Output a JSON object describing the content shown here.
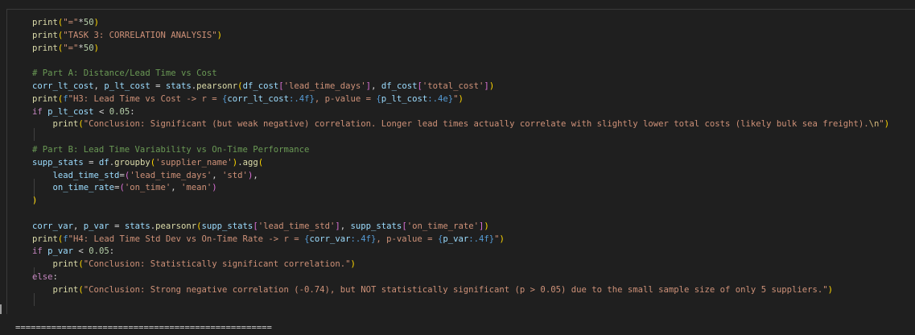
{
  "code_lines": [
    [
      {
        "t": "print",
        "c": "fn"
      },
      {
        "t": "(",
        "c": "br1"
      },
      {
        "t": "\"=\"",
        "c": "str"
      },
      {
        "t": "*",
        "c": "op"
      },
      {
        "t": "50",
        "c": "num"
      },
      {
        "t": ")",
        "c": "br1"
      }
    ],
    [
      {
        "t": "print",
        "c": "fn"
      },
      {
        "t": "(",
        "c": "br1"
      },
      {
        "t": "\"TASK 3: CORRELATION ANALYSIS\"",
        "c": "str"
      },
      {
        "t": ")",
        "c": "br1"
      }
    ],
    [
      {
        "t": "print",
        "c": "fn"
      },
      {
        "t": "(",
        "c": "br1"
      },
      {
        "t": "\"=\"",
        "c": "str"
      },
      {
        "t": "*",
        "c": "op"
      },
      {
        "t": "50",
        "c": "num"
      },
      {
        "t": ")",
        "c": "br1"
      }
    ],
    [],
    [
      {
        "t": "# Part A: Distance/Lead Time vs Cost",
        "c": "cm"
      }
    ],
    [
      {
        "t": "corr_lt_cost",
        "c": "var"
      },
      {
        "t": ", ",
        "c": "op"
      },
      {
        "t": "p_lt_cost",
        "c": "var"
      },
      {
        "t": " = ",
        "c": "op"
      },
      {
        "t": "stats",
        "c": "var"
      },
      {
        "t": ".",
        "c": "op"
      },
      {
        "t": "pearsonr",
        "c": "fn"
      },
      {
        "t": "(",
        "c": "br1"
      },
      {
        "t": "df_cost",
        "c": "var"
      },
      {
        "t": "[",
        "c": "br2"
      },
      {
        "t": "'lead_time_days'",
        "c": "str"
      },
      {
        "t": "]",
        "c": "br2"
      },
      {
        "t": ", ",
        "c": "op"
      },
      {
        "t": "df_cost",
        "c": "var"
      },
      {
        "t": "[",
        "c": "br2"
      },
      {
        "t": "'total_cost'",
        "c": "str"
      },
      {
        "t": "]",
        "c": "br2"
      },
      {
        "t": ")",
        "c": "br1"
      }
    ],
    [
      {
        "t": "print",
        "c": "fn"
      },
      {
        "t": "(",
        "c": "br1"
      },
      {
        "t": "f",
        "c": "ph"
      },
      {
        "t": "\"H3: Lead Time vs Cost -> r = ",
        "c": "str"
      },
      {
        "t": "{",
        "c": "ph"
      },
      {
        "t": "corr_lt_cost",
        "c": "var"
      },
      {
        "t": ":.4f",
        "c": "ph"
      },
      {
        "t": "}",
        "c": "ph"
      },
      {
        "t": ", p-value = ",
        "c": "str"
      },
      {
        "t": "{",
        "c": "ph"
      },
      {
        "t": "p_lt_cost",
        "c": "var"
      },
      {
        "t": ":.4e",
        "c": "ph"
      },
      {
        "t": "}",
        "c": "ph"
      },
      {
        "t": "\"",
        "c": "str"
      },
      {
        "t": ")",
        "c": "br1"
      }
    ],
    [
      {
        "t": "if",
        "c": "kw"
      },
      {
        "t": " ",
        "c": "op"
      },
      {
        "t": "p_lt_cost",
        "c": "var"
      },
      {
        "t": " < ",
        "c": "op"
      },
      {
        "t": "0.05",
        "c": "num"
      },
      {
        "t": ":",
        "c": "op"
      }
    ],
    [
      {
        "t": "    ",
        "c": "op"
      },
      {
        "t": "print",
        "c": "fn"
      },
      {
        "t": "(",
        "c": "br1"
      },
      {
        "t": "\"Conclusion: Significant (but weak negative) correlation. Longer lead times actually correlate with slightly lower total costs (likely bulk sea freight).",
        "c": "str"
      },
      {
        "t": "\\n",
        "c": "esc"
      },
      {
        "t": "\"",
        "c": "str"
      },
      {
        "t": ")",
        "c": "br1"
      }
    ],
    [],
    [
      {
        "t": "# Part B: Lead Time Variability vs On-Time Performance",
        "c": "cm"
      }
    ],
    [
      {
        "t": "supp_stats",
        "c": "var"
      },
      {
        "t": " = ",
        "c": "op"
      },
      {
        "t": "df",
        "c": "var"
      },
      {
        "t": ".",
        "c": "op"
      },
      {
        "t": "groupby",
        "c": "fn"
      },
      {
        "t": "(",
        "c": "br1"
      },
      {
        "t": "'supplier_name'",
        "c": "str"
      },
      {
        "t": ")",
        "c": "br1"
      },
      {
        "t": ".",
        "c": "op"
      },
      {
        "t": "agg",
        "c": "fn"
      },
      {
        "t": "(",
        "c": "br1"
      }
    ],
    [
      {
        "t": "    ",
        "c": "op"
      },
      {
        "t": "lead_time_std",
        "c": "var"
      },
      {
        "t": "=",
        "c": "op"
      },
      {
        "t": "(",
        "c": "br2"
      },
      {
        "t": "'lead_time_days'",
        "c": "str"
      },
      {
        "t": ", ",
        "c": "op"
      },
      {
        "t": "'std'",
        "c": "str"
      },
      {
        "t": ")",
        "c": "br2"
      },
      {
        "t": ",",
        "c": "op"
      }
    ],
    [
      {
        "t": "    ",
        "c": "op"
      },
      {
        "t": "on_time_rate",
        "c": "var"
      },
      {
        "t": "=",
        "c": "op"
      },
      {
        "t": "(",
        "c": "br2"
      },
      {
        "t": "'on_time'",
        "c": "str"
      },
      {
        "t": ", ",
        "c": "op"
      },
      {
        "t": "'mean'",
        "c": "str"
      },
      {
        "t": ")",
        "c": "br2"
      }
    ],
    [
      {
        "t": ")",
        "c": "br1"
      }
    ],
    [],
    [
      {
        "t": "corr_var",
        "c": "var"
      },
      {
        "t": ", ",
        "c": "op"
      },
      {
        "t": "p_var",
        "c": "var"
      },
      {
        "t": " = ",
        "c": "op"
      },
      {
        "t": "stats",
        "c": "var"
      },
      {
        "t": ".",
        "c": "op"
      },
      {
        "t": "pearsonr",
        "c": "fn"
      },
      {
        "t": "(",
        "c": "br1"
      },
      {
        "t": "supp_stats",
        "c": "var"
      },
      {
        "t": "[",
        "c": "br2"
      },
      {
        "t": "'lead_time_std'",
        "c": "str"
      },
      {
        "t": "]",
        "c": "br2"
      },
      {
        "t": ", ",
        "c": "op"
      },
      {
        "t": "supp_stats",
        "c": "var"
      },
      {
        "t": "[",
        "c": "br2"
      },
      {
        "t": "'on_time_rate'",
        "c": "str"
      },
      {
        "t": "]",
        "c": "br2"
      },
      {
        "t": ")",
        "c": "br1"
      }
    ],
    [
      {
        "t": "print",
        "c": "fn"
      },
      {
        "t": "(",
        "c": "br1"
      },
      {
        "t": "f",
        "c": "ph"
      },
      {
        "t": "\"H4: Lead Time Std Dev vs On-Time Rate -> r = ",
        "c": "str"
      },
      {
        "t": "{",
        "c": "ph"
      },
      {
        "t": "corr_var",
        "c": "var"
      },
      {
        "t": ":.4f",
        "c": "ph"
      },
      {
        "t": "}",
        "c": "ph"
      },
      {
        "t": ", p-value = ",
        "c": "str"
      },
      {
        "t": "{",
        "c": "ph"
      },
      {
        "t": "p_var",
        "c": "var"
      },
      {
        "t": ":.4f",
        "c": "ph"
      },
      {
        "t": "}",
        "c": "ph"
      },
      {
        "t": "\"",
        "c": "str"
      },
      {
        "t": ")",
        "c": "br1"
      }
    ],
    [
      {
        "t": "if",
        "c": "kw"
      },
      {
        "t": " ",
        "c": "op"
      },
      {
        "t": "p_var",
        "c": "var"
      },
      {
        "t": " < ",
        "c": "op"
      },
      {
        "t": "0.05",
        "c": "num"
      },
      {
        "t": ":",
        "c": "op"
      }
    ],
    [
      {
        "t": "    ",
        "c": "op"
      },
      {
        "t": "print",
        "c": "fn"
      },
      {
        "t": "(",
        "c": "br1"
      },
      {
        "t": "\"Conclusion: Statistically significant correlation.\"",
        "c": "str"
      },
      {
        "t": ")",
        "c": "br1"
      }
    ],
    [
      {
        "t": "else",
        "c": "kw"
      },
      {
        "t": ":",
        "c": "op"
      }
    ],
    [
      {
        "t": "    ",
        "c": "op"
      },
      {
        "t": "print",
        "c": "fn"
      },
      {
        "t": "(",
        "c": "br1"
      },
      {
        "t": "\"Conclusion: Strong negative correlation (-0.74), but NOT statistically significant (p > 0.05) due to the small sample size of only 5 suppliers.\"",
        "c": "str"
      },
      {
        "t": ")",
        "c": "br1"
      }
    ]
  ],
  "output_text": "==================================================",
  "colors": {
    "background": "#1f1f1f",
    "function": "#dcdcaa",
    "string": "#ce9178",
    "variable": "#9cdcfe",
    "comment": "#6a9955",
    "keyword": "#c586c0",
    "number": "#b5cea8",
    "bracket_level1": "#ffd700",
    "bracket_level2": "#da70d6"
  }
}
